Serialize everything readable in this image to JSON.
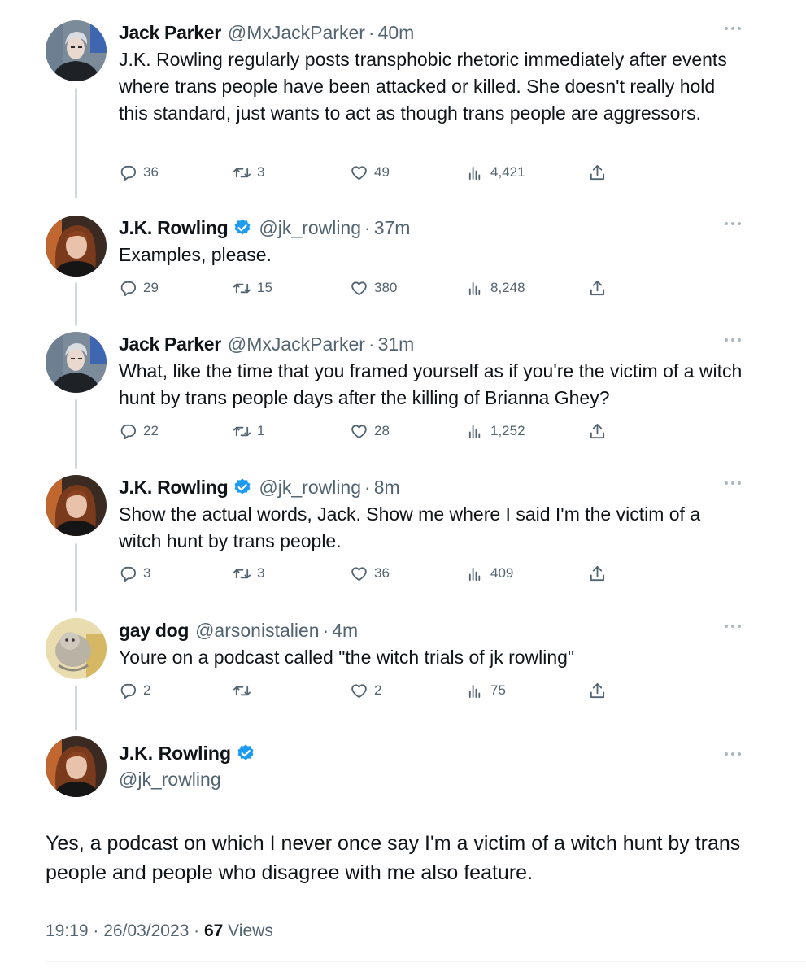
{
  "replies": [
    {
      "name": "Jack Parker",
      "verified": false,
      "handle": "@MxJackParker",
      "time": "40m",
      "text": "J.K. Rowling regularly posts transphobic rhetoric immediately after events where trans people have been attacked or killed. She doesn't really hold this standard, just wants to act as though trans people are aggressors.",
      "replies": "36",
      "retweets": "3",
      "likes": "49",
      "views": "4,421"
    },
    {
      "name": "J.K. Rowling",
      "verified": true,
      "handle": "@jk_rowling",
      "time": "37m",
      "text": "Examples, please.",
      "replies": "29",
      "retweets": "15",
      "likes": "380",
      "views": "8,248"
    },
    {
      "name": "Jack Parker",
      "verified": false,
      "handle": "@MxJackParker",
      "time": "31m",
      "text": "What, like the time that you framed yourself as if you're the victim of a witch hunt by trans people days after the killing of Brianna Ghey?",
      "replies": "22",
      "retweets": "1",
      "likes": "28",
      "views": "1,252"
    },
    {
      "name": "J.K. Rowling",
      "verified": true,
      "handle": "@jk_rowling",
      "time": "8m",
      "text": "Show the actual words, Jack. Show me where I said I'm the victim of a witch hunt by trans people.",
      "replies": "3",
      "retweets": "3",
      "likes": "36",
      "views": "409"
    },
    {
      "name": "gay dog",
      "verified": false,
      "handle": "@arsonistalien",
      "time": "4m",
      "text": "Youre on a podcast called \"the witch trials of jk rowling\"",
      "replies": "2",
      "retweets": "",
      "likes": "2",
      "views": "75"
    }
  ],
  "main": {
    "name": "J.K. Rowling",
    "verified": true,
    "handle": "@jk_rowling",
    "text": "Yes, a podcast on which I never once say I'm a victim of a witch hunt by trans people and people who disagree with me also feature.",
    "timestamp": "19:19 · 26/03/2023 · ",
    "views_count": "67",
    "views_label": " Views"
  },
  "separator": "·",
  "icons": {
    "reply": "reply-icon",
    "retweet": "retweet-icon",
    "like": "heart-icon",
    "views": "views-icon",
    "share": "share-icon",
    "more": "more-icon",
    "verified": "verified-badge-icon"
  },
  "colors": {
    "text": "#0f1419",
    "secondary": "#536471",
    "verified": "#1d9bf0",
    "thread_line": "#cfd9de"
  }
}
